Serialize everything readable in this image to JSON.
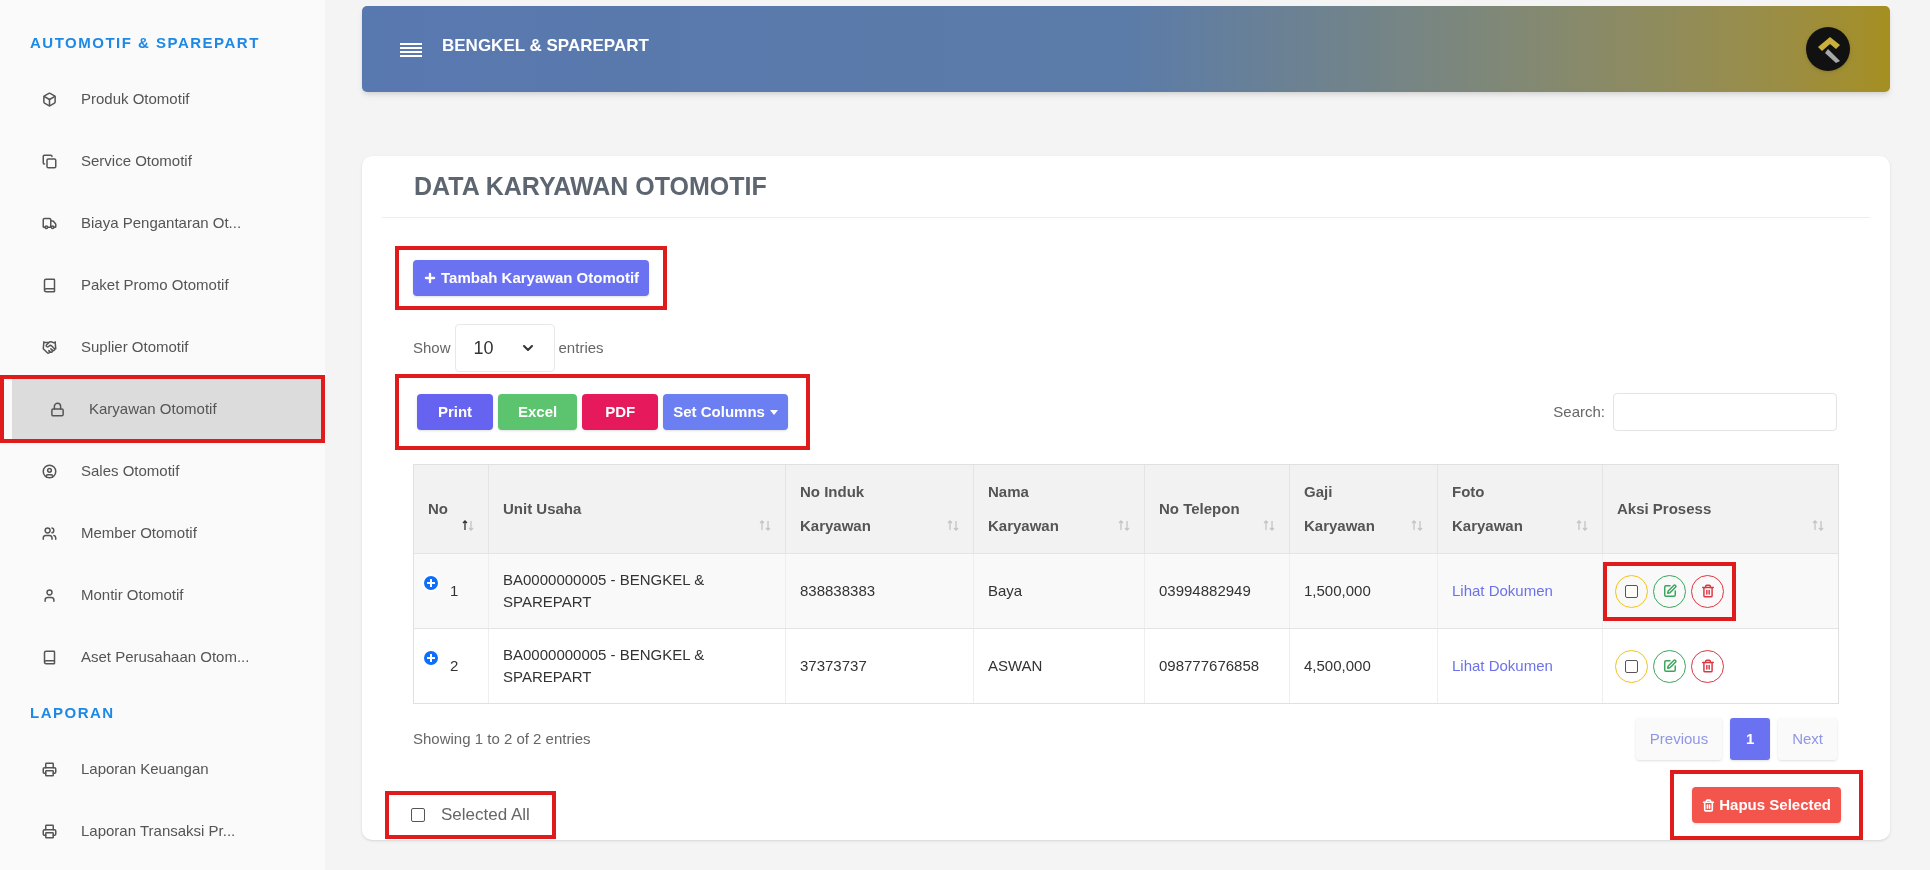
{
  "sidebar": {
    "sections": [
      {
        "title": "AUTOMOTIF & SPAREPART",
        "items": [
          {
            "label": "Produk Otomotif",
            "selected": false,
            "highlighted": false
          },
          {
            "label": "Service Otomotif",
            "selected": false,
            "highlighted": false
          },
          {
            "label": "Biaya Pengantaran Ot...",
            "selected": false,
            "highlighted": false
          },
          {
            "label": "Paket Promo Otomotif",
            "selected": false,
            "highlighted": false
          },
          {
            "label": "Suplier Otomotif",
            "selected": false,
            "highlighted": false
          },
          {
            "label": "Karyawan Otomotif",
            "selected": true,
            "highlighted": true
          },
          {
            "label": "Sales Otomotif",
            "selected": false,
            "highlighted": false
          },
          {
            "label": "Member Otomotif",
            "selected": false,
            "highlighted": false
          },
          {
            "label": "Montir Otomotif",
            "selected": false,
            "highlighted": false
          },
          {
            "label": "Aset Perusahaan Otom...",
            "selected": false,
            "highlighted": false
          }
        ]
      },
      {
        "title": "LAPORAN",
        "items": [
          {
            "label": "Laporan Keuangan",
            "selected": false,
            "highlighted": false
          },
          {
            "label": "Laporan Transaksi Pr...",
            "selected": false,
            "highlighted": false
          }
        ]
      }
    ]
  },
  "header": {
    "title": "BENGKEL & SPAREPART"
  },
  "card": {
    "title": "DATA KARYAWAN OTOMOTIF",
    "add_button": {
      "label": "Tambah Karyawan Otomotif",
      "highlighted": true
    },
    "length": {
      "prefix": "Show",
      "value": "10",
      "suffix": "entries"
    },
    "export_buttons": {
      "highlighted": true,
      "items": [
        {
          "label": "Print",
          "kind": "print"
        },
        {
          "label": "Excel",
          "kind": "excel"
        },
        {
          "label": "PDF",
          "kind": "pdf"
        },
        {
          "label": "Set Columns",
          "kind": "dropdown"
        }
      ]
    },
    "search": {
      "label": "Search:"
    },
    "table": {
      "columns": [
        {
          "label": "No",
          "sorted": true
        },
        {
          "label": "Unit Usaha",
          "sorted": false
        },
        {
          "label": "No Induk Karyawan",
          "sorted": false
        },
        {
          "label": "Nama Karyawan",
          "sorted": false
        },
        {
          "label": "No Telepon",
          "sorted": false
        },
        {
          "label": "Gaji Karyawan",
          "sorted": false
        },
        {
          "label": "Foto Karyawan",
          "sorted": false
        },
        {
          "label": "Aksi Prosess",
          "sorted": false
        }
      ],
      "rows": [
        {
          "no": "1",
          "unit": "BA0000000005 - BENGKEL & SPAREPART",
          "induk": "838838383",
          "nama": "Baya",
          "telepon": "03994882949",
          "gaji": "1,500,000",
          "foto": "Lihat Dokumen",
          "checked": false,
          "highlighted": true
        },
        {
          "no": "2",
          "unit": "BA0000000005 - BENGKEL & SPAREPART",
          "induk": "37373737",
          "nama": "ASWAN",
          "telepon": "098777676858",
          "gaji": "4,500,000",
          "foto": "Lihat Dokumen",
          "checked": false,
          "highlighted": false
        }
      ]
    },
    "info": "Showing 1 to 2 of 2 entries",
    "pagination": [
      {
        "label": "Previous",
        "disabled": true,
        "selected": false
      },
      {
        "label": "1",
        "disabled": false,
        "selected": true
      },
      {
        "label": "Next",
        "disabled": true,
        "selected": false
      }
    ],
    "select_all": {
      "label": "Selected All",
      "checked": false,
      "highlighted": true
    },
    "delete_button": {
      "label": "Hapus Selected",
      "highlighted": true
    }
  }
}
